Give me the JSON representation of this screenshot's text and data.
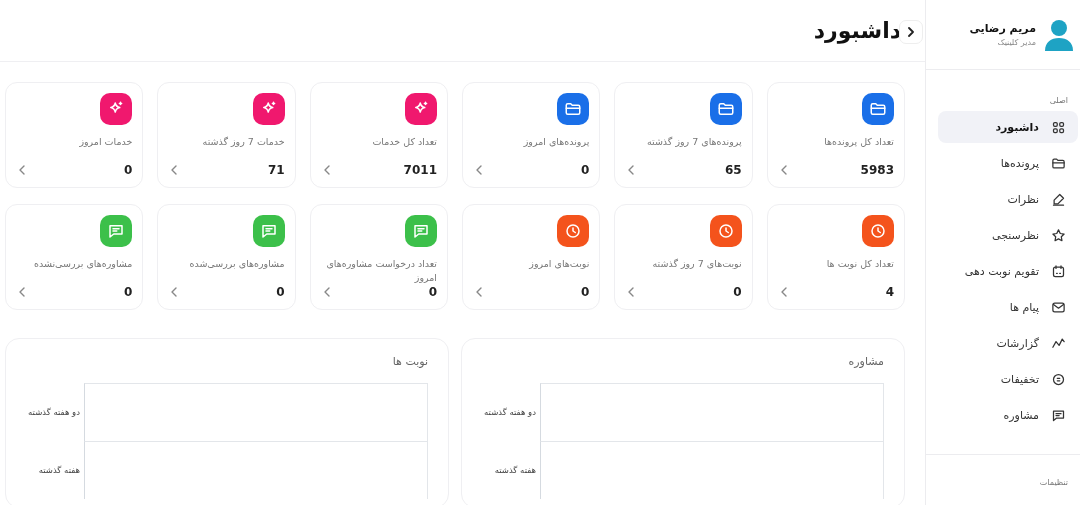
{
  "header": {
    "title": "داشبورد"
  },
  "sidebar": {
    "profile": {
      "name": "مریم رضایی",
      "role": "مدیر کلینیک"
    },
    "sections": [
      {
        "label": "اصلی",
        "items": [
          {
            "label": "داشبورد",
            "kind": "grid",
            "selected": true
          },
          {
            "label": "پرونده‌ها",
            "kind": "folder",
            "selected": false
          },
          {
            "label": "نظرات",
            "kind": "pen",
            "selected": false
          },
          {
            "label": "نظرسنجی",
            "kind": "star",
            "selected": false
          },
          {
            "label": "تقویم نوبت دهی",
            "kind": "calendar",
            "selected": false
          },
          {
            "label": "پیام ها",
            "kind": "mail",
            "selected": false
          },
          {
            "label": "گزارشات",
            "kind": "chart",
            "selected": false
          },
          {
            "label": "تخفیفات",
            "kind": "badge",
            "selected": false
          },
          {
            "label": "مشاوره",
            "kind": "chat",
            "selected": false
          }
        ]
      },
      {
        "label": "تنظیمات"
      }
    ]
  },
  "cards": [
    {
      "label": "تعداد کل پرونده‌ها",
      "value": "5983",
      "kind": "folder",
      "color": "#1a6fe8"
    },
    {
      "label": "پرونده‌های 7 روز گذشته",
      "value": "65",
      "kind": "folder",
      "color": "#1a6fe8"
    },
    {
      "label": "پرونده‌های امروز",
      "value": "0",
      "kind": "folder",
      "color": "#1a6fe8"
    },
    {
      "label": "تعداد کل خدمات",
      "value": "7011",
      "kind": "sparkle",
      "color": "#f0186e"
    },
    {
      "label": "خدمات 7 روز گذشته",
      "value": "71",
      "kind": "sparkle",
      "color": "#f0186e"
    },
    {
      "label": "خدمات امروز",
      "value": "0",
      "kind": "sparkle",
      "color": "#f0186e"
    },
    {
      "label": "تعداد کل نوبت ها",
      "value": "4",
      "kind": "clock",
      "color": "#f4531c"
    },
    {
      "label": "نوبت‌های 7 روز گذشته",
      "value": "0",
      "kind": "clock",
      "color": "#f4531c"
    },
    {
      "label": "نوبت‌های امروز",
      "value": "0",
      "kind": "clock",
      "color": "#f4531c"
    },
    {
      "label": "تعداد درخواست مشاوره‌های امروز",
      "value": "0",
      "kind": "chat",
      "color": "#3cc04a"
    },
    {
      "label": "مشاوره‌های بررسی‌شده",
      "value": "0",
      "kind": "chat",
      "color": "#3cc04a"
    },
    {
      "label": "مشاوره‌های بررسی‌نشده",
      "value": "0",
      "kind": "chat",
      "color": "#3cc04a"
    }
  ],
  "charts": [
    {
      "title": "مشاوره",
      "labels": [
        "دو هفته گذشته",
        "هفته گذشته"
      ]
    },
    {
      "title": "نوبت ها",
      "labels": [
        "دو هفته گذشته",
        "هفته گذشته"
      ]
    }
  ]
}
